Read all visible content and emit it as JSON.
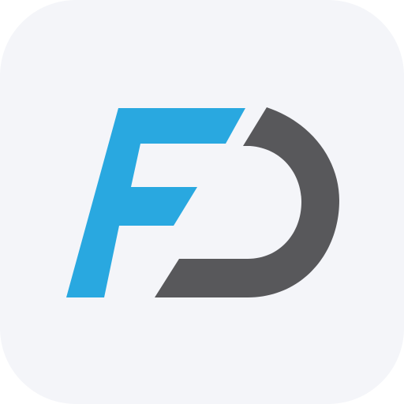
{
  "app_icon": {
    "logo": "fd-logo",
    "colors": {
      "background": "#F4F5F9",
      "f_mark": "#29A8E0",
      "d_mark": "#58585B"
    }
  }
}
